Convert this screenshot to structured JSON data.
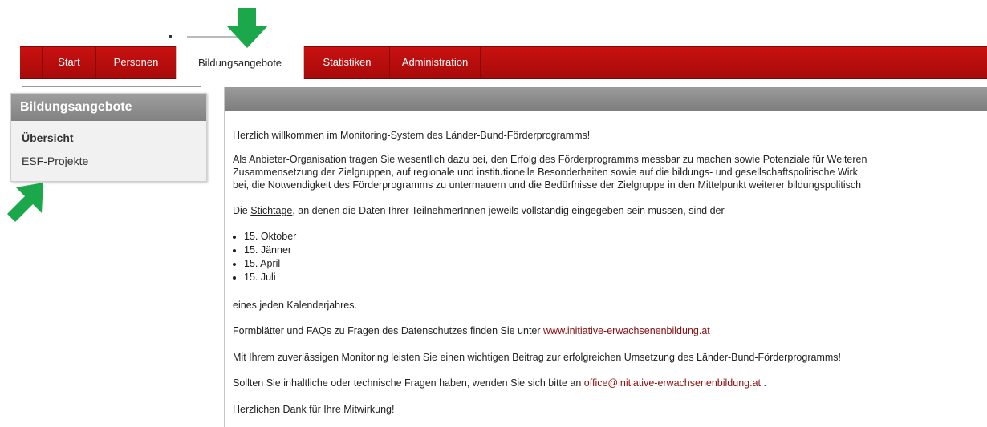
{
  "navigation": {
    "tabs": [
      {
        "label": "Start"
      },
      {
        "label": "Personen"
      },
      {
        "label": "Bildungsangebote",
        "active": true
      },
      {
        "label": "Statistiken"
      },
      {
        "label": "Administration"
      }
    ]
  },
  "sidebar": {
    "title": "Bildungsangebote",
    "items": [
      {
        "label": "Übersicht",
        "selected": true
      },
      {
        "label": "ESF-Projekte"
      }
    ]
  },
  "content": {
    "welcome": "Herzlich willkommen im Monitoring-System des Länder-Bund-Förderprogramms!",
    "intro_line1": "Als Anbieter-Organisation tragen Sie wesentlich dazu bei, den Erfolg des Förderprogramms messbar zu machen sowie Potenziale für Weiteren",
    "intro_line2": "Zusammensetzung der Zielgruppen, auf regionale und institutionelle Besonderheiten sowie auf die bildungs- und gesellschaftspolitische Wirk",
    "intro_line3": "bei, die Notwendigkeit des Förderprogramms zu untermauern und die Bedürfnisse der Zielgruppe in den Mittelpunkt weiterer bildungspolitisch",
    "stichtage_pre": "Die ",
    "stichtage_link": "Stichtage",
    "stichtage_post": ", an denen die Daten Ihrer TeilnehmerInnen jeweils vollständig eingegeben sein müssen, sind der",
    "dates": [
      "15. Oktober",
      "15. Jänner",
      "15. April",
      "15. Juli"
    ],
    "year_text": "eines jeden Kalenderjahres.",
    "forms_text": "Formblätter und FAQs zu Fragen des Datenschutzes finden Sie unter ",
    "forms_link": "www.initiative-erwachsenenbildung.at",
    "monitoring_text": "Mit Ihrem zuverlässigen Monitoring leisten Sie einen wichtigen Beitrag zur erfolgreichen Umsetzung des Länder-Bund-Förderprogramms!",
    "questions_text": "Sollten Sie inhaltliche oder technische Fragen haben, wenden Sie sich bitte an ",
    "questions_email": "office@initiative-erwachsenenbildung.at",
    "questions_end": " .",
    "thanks": "Herzlichen Dank für Ihre Mitwirkung!"
  },
  "colors": {
    "nav_red": "#b80d0d",
    "arrow_green": "#1aa84a",
    "link_red": "#8b0d0d"
  },
  "icons": [
    "arrow-down-icon",
    "arrow-up-right-icon"
  ]
}
